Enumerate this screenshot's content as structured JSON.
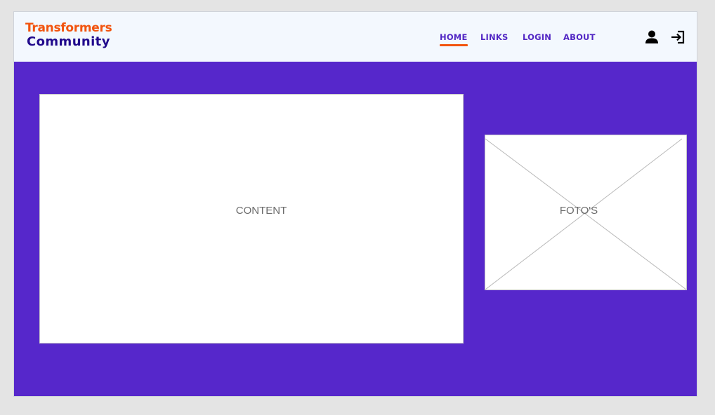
{
  "header": {
    "logo": {
      "line1": "Transformers",
      "line2": "Community"
    },
    "nav": {
      "home": "HOME",
      "links": "LINKS",
      "login": "LOGIN",
      "about": "ABOUT",
      "active": "HOME"
    },
    "icons": {
      "user": "user-icon",
      "login": "login-icon"
    }
  },
  "main": {
    "content_label": "CONTENT",
    "photo_label": "FOTO'S"
  },
  "colors": {
    "background": "#5627cb",
    "header_bg": "#f3f8fe",
    "brand_orange": "#f2540f",
    "brand_navy": "#210a8c",
    "nav_text": "#5227c4"
  }
}
